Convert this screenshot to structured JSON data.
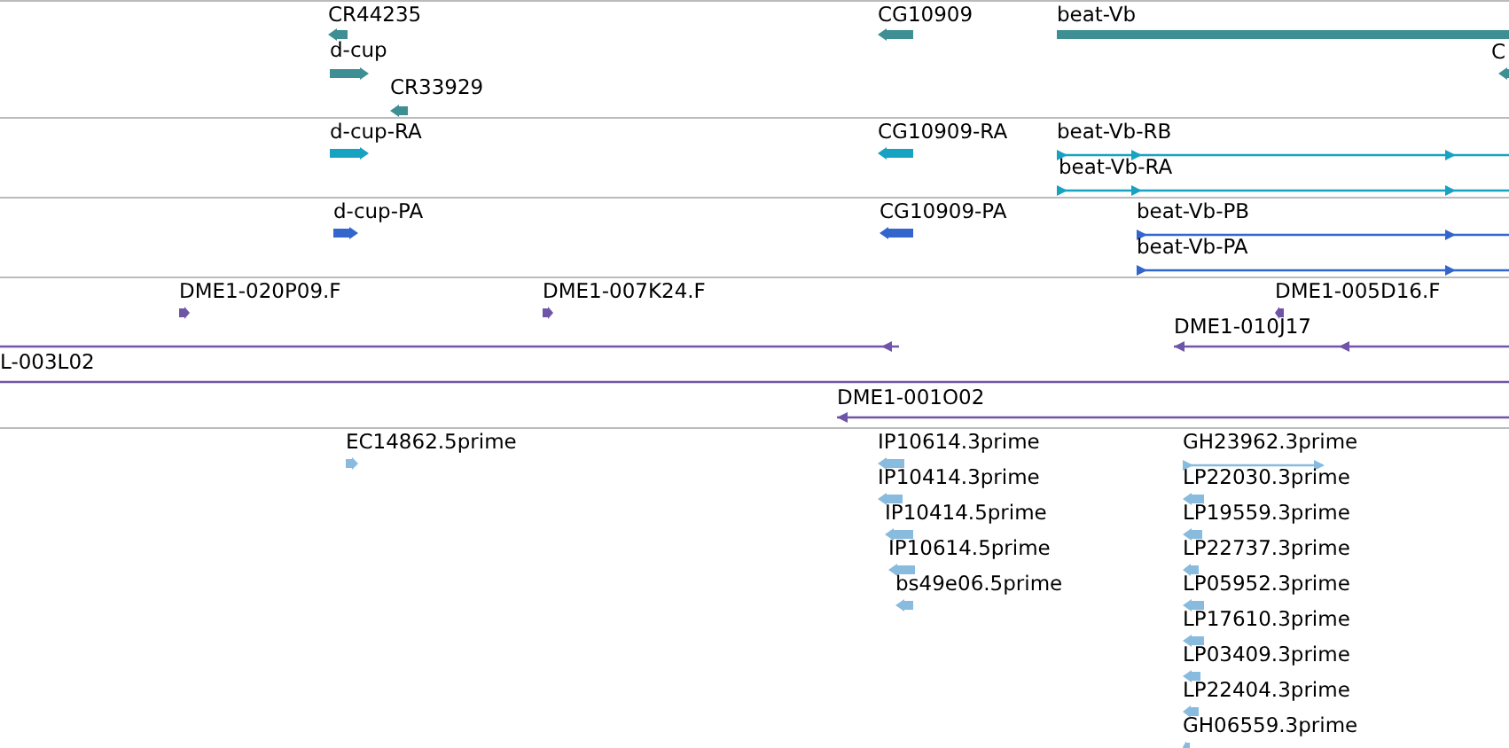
{
  "tracks": [
    {
      "color": "#3d8f93",
      "features": [
        {
          "label": "CR44235",
          "kind": "block",
          "reverse": true
        },
        {
          "label": "d-cup",
          "kind": "block",
          "reverse": false
        },
        {
          "label": "CR33929",
          "kind": "block",
          "reverse": true
        },
        {
          "label": "CG10909",
          "kind": "block",
          "reverse": true
        },
        {
          "label": "beat-Vb",
          "kind": "block",
          "reverse": false
        },
        {
          "label": "C",
          "kind": "block",
          "reverse": true
        }
      ]
    },
    {
      "color": "#17a2c2",
      "features": [
        {
          "label": "d-cup-RA",
          "kind": "block",
          "reverse": false
        },
        {
          "label": "CG10909-RA",
          "kind": "block",
          "reverse": true
        },
        {
          "label": "beat-Vb-RB",
          "kind": "line",
          "reverse": false
        },
        {
          "label": "beat-Vb-RA",
          "kind": "line",
          "reverse": false
        }
      ]
    },
    {
      "color": "#3366cc",
      "features": [
        {
          "label": "d-cup-PA",
          "kind": "block",
          "reverse": false
        },
        {
          "label": "CG10909-PA",
          "kind": "block",
          "reverse": true
        },
        {
          "label": "beat-Vb-PB",
          "kind": "line",
          "reverse": false
        },
        {
          "label": "beat-Vb-PA",
          "kind": "line",
          "reverse": false
        }
      ]
    },
    {
      "color": "#6f55a8",
      "features": [
        {
          "label": "DME1-020P09.F",
          "kind": "block",
          "reverse": false
        },
        {
          "label": "DME1-007K24.F",
          "kind": "block",
          "reverse": false
        },
        {
          "label": "DME1-005D16.F",
          "kind": "block",
          "reverse": true
        },
        {
          "label": "DME1-010J17",
          "kind": "line",
          "reverse": true
        },
        {
          "kind": "line",
          "reverse": true
        },
        {
          "label": "L-003L02",
          "kind": "line"
        },
        {
          "label": "DME1-001O02",
          "kind": "line",
          "reverse": true
        }
      ]
    },
    {
      "color": "#88bbdd",
      "features": [
        {
          "label": "EC14862.5prime",
          "kind": "block",
          "reverse": false
        },
        {
          "label": "IP10614.3prime",
          "kind": "block",
          "reverse": true
        },
        {
          "label": "IP10414.3prime",
          "kind": "block",
          "reverse": true
        },
        {
          "label": "IP10414.5prime",
          "kind": "block",
          "reverse": true
        },
        {
          "label": "IP10614.5prime",
          "kind": "block",
          "reverse": true
        },
        {
          "label": "bs49e06.5prime",
          "kind": "block",
          "reverse": true
        },
        {
          "label": "GH23962.3prime",
          "kind": "line",
          "reverse": false
        },
        {
          "label": "LP22030.3prime",
          "kind": "block",
          "reverse": true
        },
        {
          "label": "LP19559.3prime",
          "kind": "block",
          "reverse": true
        },
        {
          "label": "LP22737.3prime",
          "kind": "block",
          "reverse": true
        },
        {
          "label": "LP05952.3prime",
          "kind": "block",
          "reverse": true
        },
        {
          "label": "LP17610.3prime",
          "kind": "block",
          "reverse": true
        },
        {
          "label": "LP03409.3prime",
          "kind": "block",
          "reverse": true
        },
        {
          "label": "LP22404.3prime",
          "kind": "block",
          "reverse": true
        },
        {
          "label": "GH06559.3prime",
          "kind": "block",
          "reverse": true
        }
      ]
    }
  ]
}
